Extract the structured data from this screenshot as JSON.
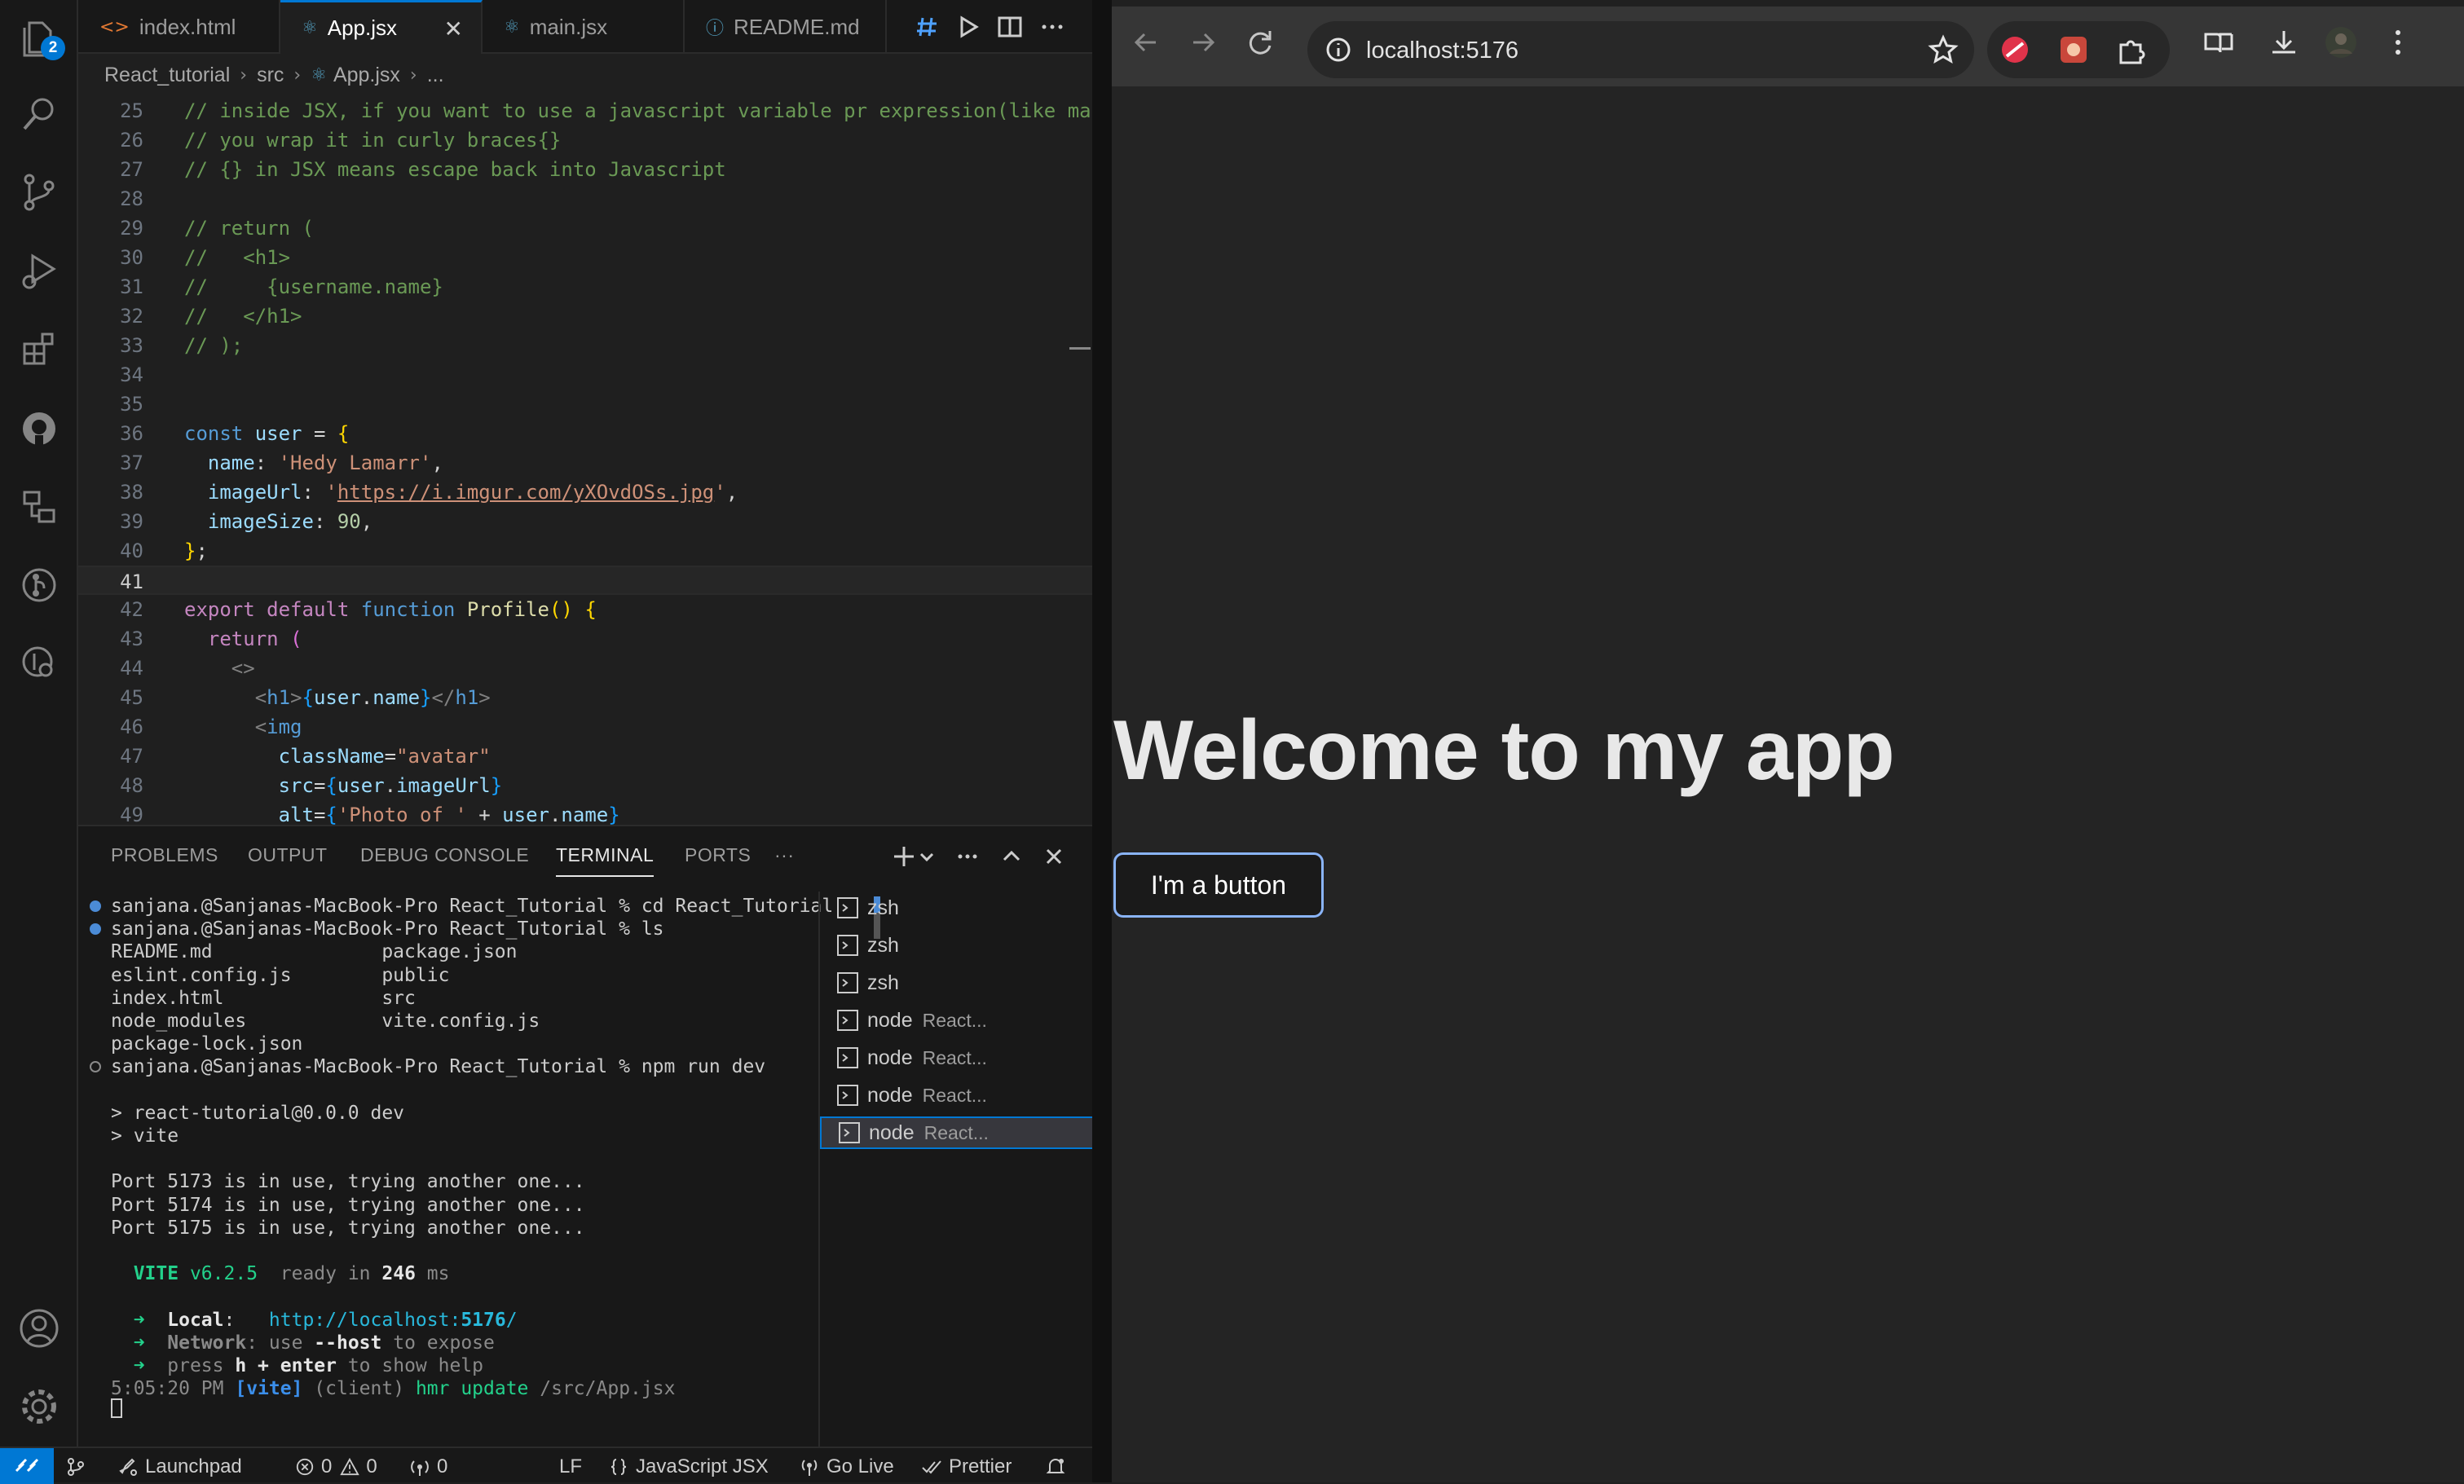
{
  "vscode": {
    "activity_badge": "2",
    "tabs": [
      {
        "icon": "<>",
        "label": "index.html"
      },
      {
        "icon": "⚛",
        "label": "App.jsx"
      },
      {
        "icon": "⚛",
        "label": "main.jsx"
      },
      {
        "icon": "ⓘ",
        "label": "README.md"
      }
    ],
    "tab_close": "✕",
    "breadcrumb": {
      "project": "React_tutorial",
      "folder": "src",
      "file": "App.jsx",
      "more": "..."
    },
    "code_lines": [
      {
        "n": "25",
        "html": "<span class='cm'>// inside JSX, if you want to use a javascript variable pr expression(like ma</span>"
      },
      {
        "n": "26",
        "html": "<span class='cm'>// you wrap it in curly braces{}</span>"
      },
      {
        "n": "27",
        "html": "<span class='cm'>// {} in JSX means escape back into Javascript</span>"
      },
      {
        "n": "28",
        "html": ""
      },
      {
        "n": "29",
        "html": "<span class='cm'>// return (</span>"
      },
      {
        "n": "30",
        "html": "<span class='cm'>//   &lt;h1&gt;</span>"
      },
      {
        "n": "31",
        "html": "<span class='cm'>//     {username.name}</span>"
      },
      {
        "n": "32",
        "html": "<span class='cm'>//   &lt;/h1&gt;</span>"
      },
      {
        "n": "33",
        "html": "<span class='cm'>// );</span>"
      },
      {
        "n": "34",
        "html": ""
      },
      {
        "n": "35",
        "html": ""
      },
      {
        "n": "36",
        "html": "<span class='kw'>const</span> <span class='vr'>user</span> <span class='pl'>=</span> <span class='br'>{</span>"
      },
      {
        "n": "37",
        "html": "  <span class='vr'>name</span><span class='pl'>:</span> <span class='st'>'Hedy Lamarr'</span><span class='pl'>,</span>"
      },
      {
        "n": "38",
        "html": "  <span class='vr'>imageUrl</span><span class='pl'>:</span> <span class='st'>'<span class='ul'>https://i.imgur.com/yXOvdOSs.jpg</span>'</span><span class='pl'>,</span>"
      },
      {
        "n": "39",
        "html": "  <span class='vr'>imageSize</span><span class='pl'>:</span> <span class='nm'>90</span><span class='pl'>,</span>"
      },
      {
        "n": "40",
        "html": "<span class='br'>}</span><span class='pl'>;</span>"
      },
      {
        "n": "41",
        "html": ""
      },
      {
        "n": "42",
        "html": "<span class='kw2'>export</span> <span class='kw2'>default</span> <span class='kw'>function</span> <span class='fn'>Profile</span><span class='br'>()</span> <span class='br'>{</span>"
      },
      {
        "n": "43",
        "html": "  <span class='kw2'>return</span> <span class='br2'>(</span>"
      },
      {
        "n": "44",
        "html": "    <span class='tg'>&lt;&gt;</span>"
      },
      {
        "n": "45",
        "html": "      <span class='tg'>&lt;</span><span class='tgn'>h1</span><span class='tg'>&gt;</span><span class='br3'>{</span><span class='vr'>user</span><span class='pl'>.</span><span class='vr'>name</span><span class='br3'>}</span><span class='tg'>&lt;/</span><span class='tgn'>h1</span><span class='tg'>&gt;</span>"
      },
      {
        "n": "46",
        "html": "      <span class='tg'>&lt;</span><span class='tgn'>img</span>"
      },
      {
        "n": "47",
        "html": "        <span class='vr'>className</span><span class='pl'>=</span><span class='st'>\"avatar\"</span>"
      },
      {
        "n": "48",
        "html": "        <span class='vr'>src</span><span class='pl'>=</span><span class='br3'>{</span><span class='vr'>user</span><span class='pl'>.</span><span class='vr'>imageUrl</span><span class='br3'>}</span>"
      },
      {
        "n": "49",
        "html": "        <span class='vr'>alt</span><span class='pl'>=</span><span class='br3'>{</span><span class='st'>'Photo of '</span> <span class='pl'>+</span> <span class='vr'>user</span><span class='pl'>.</span><span class='vr'>name</span><span class='br3'>}</span>"
      }
    ],
    "current_line": "41",
    "panel_tabs": [
      "PROBLEMS",
      "OUTPUT",
      "DEBUG CONSOLE",
      "TERMINAL",
      "PORTS"
    ],
    "panel_more": "···",
    "terminal_lines": [
      {
        "dot": "b",
        "html": "sanjana.@Sanjanas-MacBook-Pro React_Tutorial % cd React_Tutorial"
      },
      {
        "dot": "b",
        "html": "sanjana.@Sanjanas-MacBook-Pro React_Tutorial % ls"
      },
      {
        "dot": "",
        "html": "README.md               package.json"
      },
      {
        "dot": "",
        "html": "eslint.config.js        public"
      },
      {
        "dot": "",
        "html": "index.html              src"
      },
      {
        "dot": "",
        "html": "node_modules            vite.config.js"
      },
      {
        "dot": "",
        "html": "package-lock.json"
      },
      {
        "dot": "o",
        "html": "sanjana.@Sanjanas-MacBook-Pro React_Tutorial % npm run dev"
      },
      {
        "dot": "",
        "html": ""
      },
      {
        "dot": "",
        "html": "&gt; react-tutorial@0.0.0 dev"
      },
      {
        "dot": "",
        "html": "&gt; vite"
      },
      {
        "dot": "",
        "html": ""
      },
      {
        "dot": "",
        "html": "Port 5173 is in use, trying another one..."
      },
      {
        "dot": "",
        "html": "Port 5174 is in use, trying another one..."
      },
      {
        "dot": "",
        "html": "Port 5175 is in use, trying another one..."
      },
      {
        "dot": "",
        "html": ""
      },
      {
        "dot": "",
        "html": "  <span class='tg2'>VITE</span> <span class='tgreen'>v6.2.5</span>  <span class='tdim'>ready in</span> <span class='tbold'>246</span> <span class='tdim'>ms</span>"
      },
      {
        "dot": "",
        "html": ""
      },
      {
        "dot": "",
        "html": "  <span class='tgreen'>➜</span>  <span class='tbold'>Local</span>:   <span class='tcy'>http://localhost:<b>5176</b>/</span>"
      },
      {
        "dot": "",
        "html": "  <span class='tgreen'>➜</span>  <span class='tdim'><b>Network</b>: use <b style='color:#e5e5e5'>--host</b> to expose</span>"
      },
      {
        "dot": "",
        "html": "  <span class='tgreen'>➜</span>  <span class='tdim'>press <b style='color:#e5e5e5'>h + enter</b> to show help</span>"
      },
      {
        "dot": "",
        "html": "<span class='tdim'>5:05:20 PM</span> <span class='tbl'>[vite]</span> <span class='tdim'>(client)</span> <span class='tgreen'>hmr update </span><span class='tdim'>/src/App.jsx</span>"
      }
    ],
    "terminal_list": [
      {
        "name": "zsh",
        "desc": ""
      },
      {
        "name": "zsh",
        "desc": ""
      },
      {
        "name": "zsh",
        "desc": ""
      },
      {
        "name": "node",
        "desc": "React..."
      },
      {
        "name": "node",
        "desc": "React..."
      },
      {
        "name": "node",
        "desc": "React..."
      },
      {
        "name": "node",
        "desc": "React..."
      }
    ],
    "status": {
      "launchpad": "Launchpad",
      "errors": "0",
      "warnings": "0",
      "ports": "0",
      "eol": "LF",
      "language": "JavaScript JSX",
      "golive": "Go Live",
      "prettier": "Prettier"
    }
  },
  "browser": {
    "url": "localhost:5176",
    "page_heading": "Welcome to my app",
    "page_button": "I'm a button"
  }
}
